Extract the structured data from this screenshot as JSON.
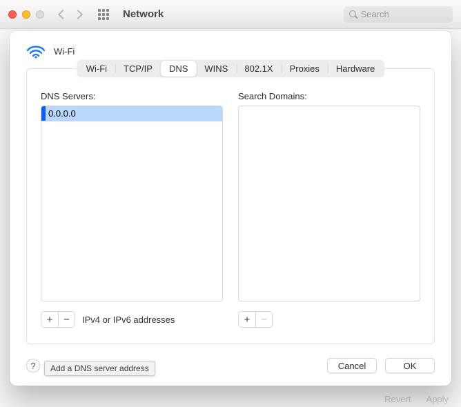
{
  "titlebar": {
    "title": "Network",
    "search_placeholder": "Search"
  },
  "sheet": {
    "title": "Wi-Fi"
  },
  "tabs": {
    "items": [
      {
        "label": "Wi-Fi"
      },
      {
        "label": "TCP/IP"
      },
      {
        "label": "DNS"
      },
      {
        "label": "WINS"
      },
      {
        "label": "802.1X"
      },
      {
        "label": "Proxies"
      },
      {
        "label": "Hardware"
      }
    ],
    "active_index": 2
  },
  "dns_servers": {
    "label": "DNS Servers:",
    "editing_value": "0.0.0.0",
    "hint": "IPv4 or IPv6 addresses",
    "add_tooltip": "Add a DNS server address"
  },
  "search_domains": {
    "label": "Search Domains:"
  },
  "footer": {
    "help_symbol": "?",
    "cancel": "Cancel",
    "ok": "OK"
  },
  "behind": {
    "revert": "Revert",
    "apply": "Apply"
  },
  "icons": {
    "plus": "+",
    "minus": "−"
  }
}
